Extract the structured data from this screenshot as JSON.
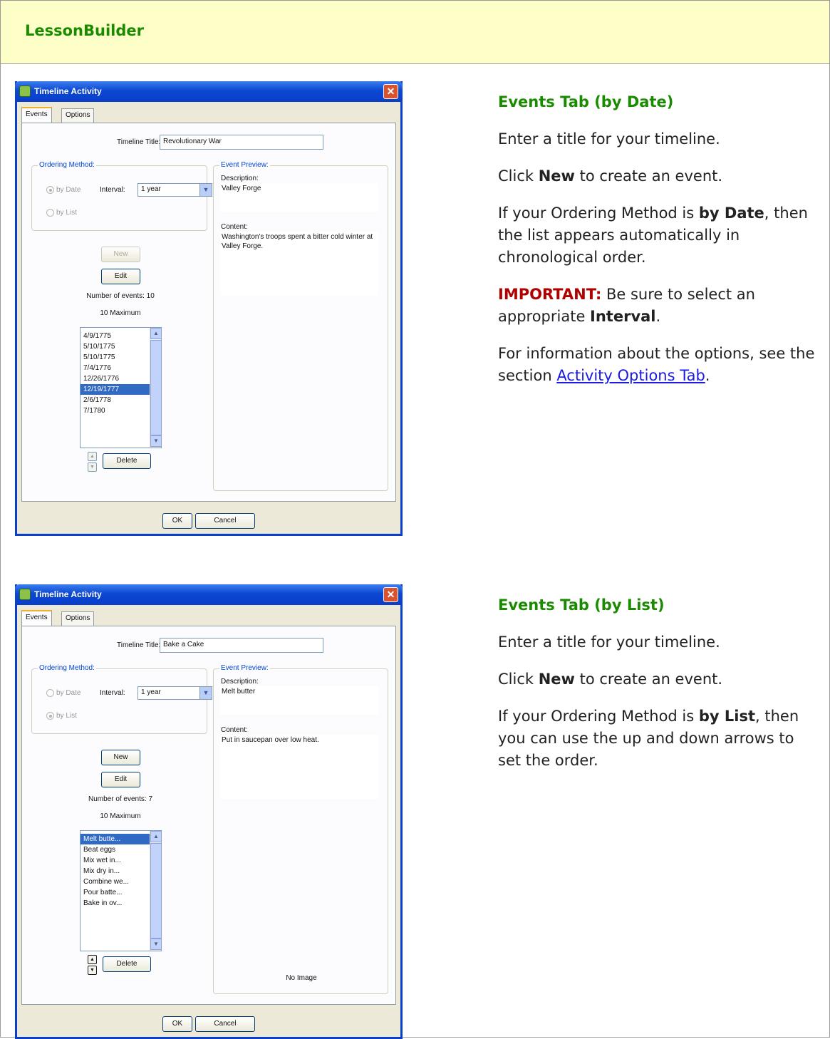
{
  "header": {
    "title": "LessonBuilder"
  },
  "dialogs": [
    {
      "title": "Timeline Activity",
      "tabs": [
        "Events",
        "Options"
      ],
      "timeline_title_label": "Timeline Title:",
      "timeline_title_value": "Revolutionary War",
      "ordering_label": "Ordering Method:",
      "by_date_label": "by Date",
      "by_list_label": "by List",
      "interval_label": "Interval:",
      "interval_value": "1 year",
      "new_label": "New",
      "edit_label": "Edit",
      "number_of_events": "Number of events: 10",
      "maximum": "10 Maximum",
      "items": [
        "4/9/1775",
        "5/10/1775",
        "5/10/1775",
        "7/4/1776",
        "12/26/1776",
        "12/19/1777",
        "2/6/1778",
        "7/1780"
      ],
      "selected_index": 5,
      "delete_label": "Delete",
      "preview_label": "Event Preview:",
      "description_label": "Description:",
      "description_value": "Valley Forge",
      "content_label": "Content:",
      "content_value": "Washington's troops spent a bitter cold winter at Valley Forge.",
      "no_image": "",
      "ok_label": "OK",
      "cancel_label": "Cancel"
    },
    {
      "title": "Timeline Activity",
      "tabs": [
        "Events",
        "Options"
      ],
      "timeline_title_label": "Timeline Title:",
      "timeline_title_value": "Bake a Cake",
      "ordering_label": "Ordering Method:",
      "by_date_label": "by Date",
      "by_list_label": "by List",
      "interval_label": "Interval:",
      "interval_value": "1 year",
      "new_label": "New",
      "edit_label": "Edit",
      "number_of_events": "Number of events: 7",
      "maximum": "10 Maximum",
      "items": [
        "Melt butte...",
        "Beat eggs",
        "Mix wet in...",
        "Mix dry in...",
        "Combine we...",
        "Pour batte...",
        "Bake in ov..."
      ],
      "selected_index": 0,
      "delete_label": "Delete",
      "preview_label": "Event Preview:",
      "description_label": "Description:",
      "description_value": "Melt butter",
      "content_label": "Content:",
      "content_value": "Put in saucepan over low heat.",
      "no_image": "No Image",
      "ok_label": "OK",
      "cancel_label": "Cancel"
    }
  ],
  "sections": [
    {
      "heading": "Events Tab (by Date)",
      "p1": "Enter a title for your timeline.",
      "p2_pre": "Click ",
      "p2_bold": "New",
      "p2_post": " to create an event.",
      "p3_pre": "If your Ordering Method is ",
      "p3_bold": "by Date",
      "p3_post": ", then the list appears automatically in chronological order.",
      "important_label": "IMPORTANT:",
      "p4_pre": " Be sure to select an appropriate ",
      "p4_bold": "Interval",
      "p4_post": ".",
      "p5_pre": "For information about the options, see the section ",
      "p5_link": "Activity Options Tab",
      "p5_post": "."
    },
    {
      "heading": "Events Tab (by List)",
      "p1": "Enter a title for your timeline.",
      "p2_pre": "Click ",
      "p2_bold": "New",
      "p2_post": " to create an event.",
      "p3_pre": "If your Ordering Method is ",
      "p3_bold": "by List",
      "p3_post": ", then you can use the up and down arrows to set the order."
    }
  ]
}
